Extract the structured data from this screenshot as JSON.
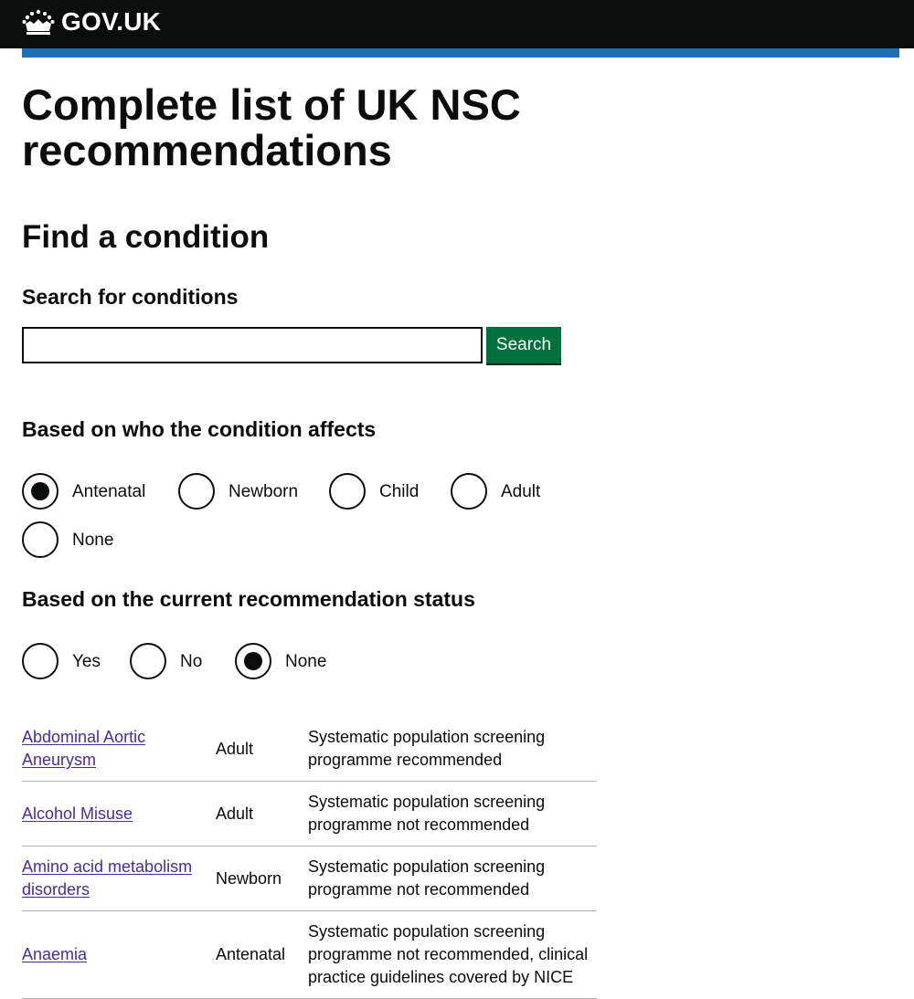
{
  "header": {
    "logo_text": "GOV.UK",
    "logo_icon": "crown-icon"
  },
  "page": {
    "title": "Complete list of UK NSC recommendations",
    "find_heading": "Find a condition",
    "search_label": "Search for conditions",
    "search_value": "",
    "search_button": "Search"
  },
  "affects": {
    "heading": "Based on who the condition affects",
    "options": [
      "Antenatal",
      "Newborn",
      "Child",
      "Adult",
      "None"
    ],
    "selected": "Antenatal"
  },
  "status_filter": {
    "heading": "Based on the current recommendation status",
    "options": [
      "Yes",
      "No",
      "None"
    ],
    "selected": "None"
  },
  "conditions": [
    {
      "name": "Abdominal Aortic Aneurysm",
      "affects": "Adult",
      "status": "Systematic population screening programme recommended"
    },
    {
      "name": "Alcohol Misuse",
      "affects": "Adult",
      "status": "Systematic population screening programme not recommended"
    },
    {
      "name": "Amino acid metabolism disorders",
      "affects": "Newborn",
      "status": "Systematic population screening programme not recommended"
    },
    {
      "name": "Anaemia",
      "affects": "Antenatal",
      "status": "Systematic population screening programme not recommended, clinical practice guidelines covered by NICE"
    }
  ],
  "colors": {
    "header_bg": "#0b0c0c",
    "accent_blue": "#1d70b8",
    "button_green": "#00703c",
    "link_purple": "#4c2c92"
  }
}
